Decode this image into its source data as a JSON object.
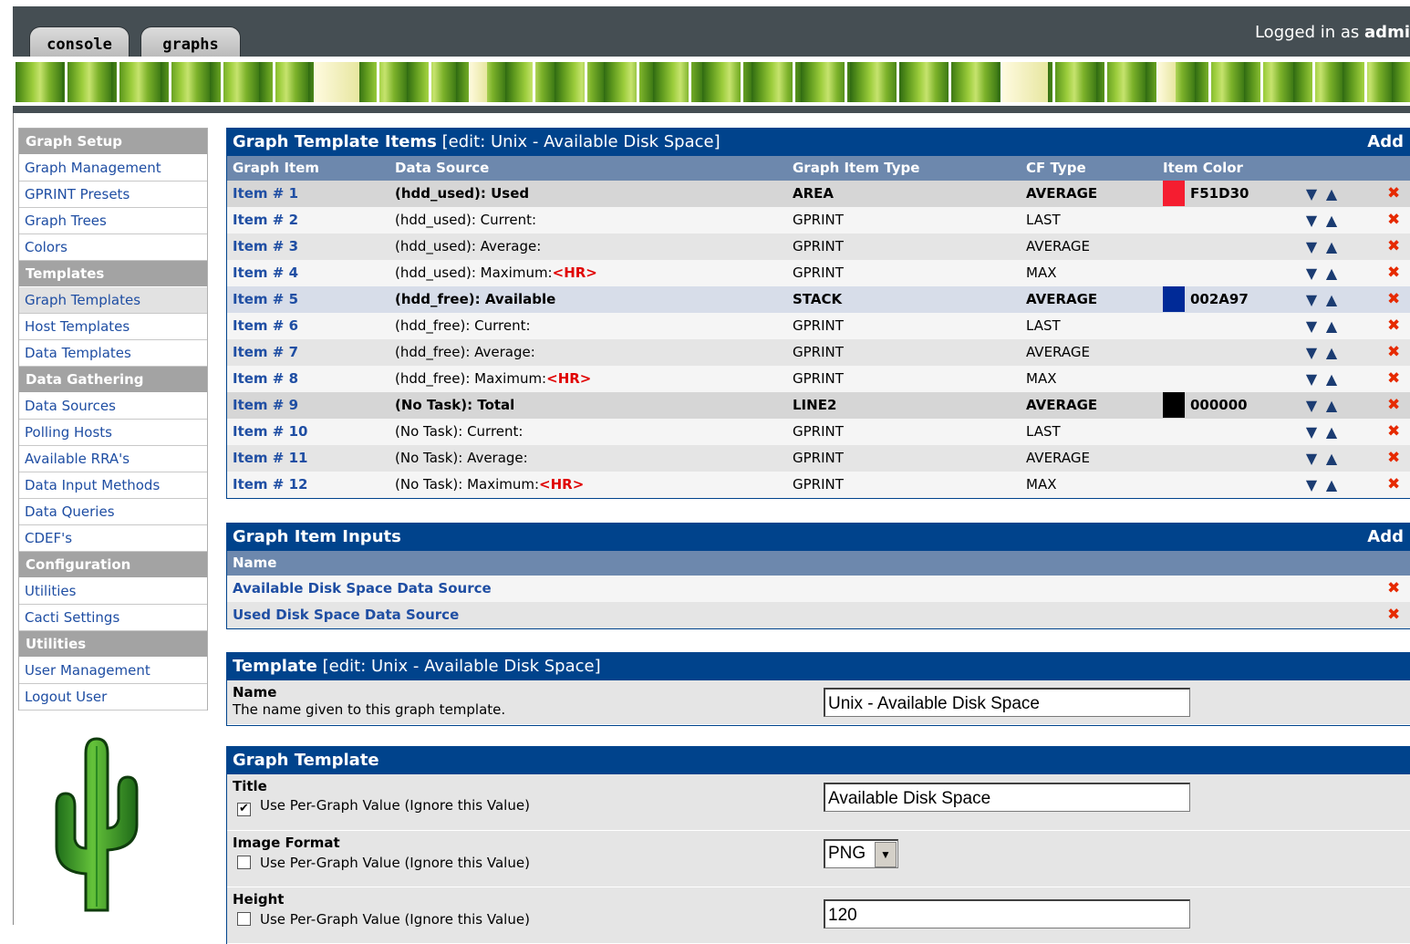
{
  "header": {
    "tabs": [
      "console",
      "graphs"
    ],
    "login_prefix": "Logged in as ",
    "login_user": "admi"
  },
  "sidebar": [
    {
      "type": "header",
      "label": "Graph Setup"
    },
    {
      "type": "item",
      "label": "Graph Management"
    },
    {
      "type": "item",
      "label": "GPRINT Presets"
    },
    {
      "type": "item",
      "label": "Graph Trees"
    },
    {
      "type": "item",
      "label": "Colors"
    },
    {
      "type": "header",
      "label": "Templates"
    },
    {
      "type": "item",
      "label": "Graph Templates",
      "active": true
    },
    {
      "type": "item",
      "label": "Host Templates"
    },
    {
      "type": "item",
      "label": "Data Templates"
    },
    {
      "type": "header",
      "label": "Data Gathering"
    },
    {
      "type": "item",
      "label": "Data Sources"
    },
    {
      "type": "item",
      "label": "Polling Hosts"
    },
    {
      "type": "item",
      "label": "Available RRA's"
    },
    {
      "type": "item",
      "label": "Data Input Methods"
    },
    {
      "type": "item",
      "label": "Data Queries"
    },
    {
      "type": "item",
      "label": "CDEF's"
    },
    {
      "type": "header",
      "label": "Configuration"
    },
    {
      "type": "item",
      "label": "Utilities"
    },
    {
      "type": "item",
      "label": "Cacti Settings"
    },
    {
      "type": "header",
      "label": "Utilities"
    },
    {
      "type": "item",
      "label": "User Management"
    },
    {
      "type": "item",
      "label": "Logout User"
    }
  ],
  "items_panel": {
    "title": "Graph Template Items",
    "subtitle": "[edit: Unix - Available Disk Space]",
    "add_label": "Add",
    "columns": [
      "Graph Item",
      "Data Source",
      "Graph Item Type",
      "CF Type",
      "Item Color"
    ],
    "rows": [
      {
        "item": "Item # 1",
        "source": "(hdd_used): Used",
        "hr": "",
        "type": "AREA",
        "cf": "AVERAGE",
        "color": "F51D30",
        "swatch": "#f51d30",
        "emph": true,
        "style": "hl1"
      },
      {
        "item": "Item # 2",
        "source": "(hdd_used): Current:",
        "hr": "",
        "type": "GPRINT",
        "cf": "LAST",
        "color": "",
        "swatch": "",
        "emph": false,
        "style": "odd"
      },
      {
        "item": "Item # 3",
        "source": "(hdd_used): Average:",
        "hr": "",
        "type": "GPRINT",
        "cf": "AVERAGE",
        "color": "",
        "swatch": "",
        "emph": false,
        "style": "even"
      },
      {
        "item": "Item # 4",
        "source": "(hdd_used): Maximum:",
        "hr": "<HR>",
        "type": "GPRINT",
        "cf": "MAX",
        "color": "",
        "swatch": "",
        "emph": false,
        "style": "odd"
      },
      {
        "item": "Item # 5",
        "source": "(hdd_free): Available",
        "hr": "",
        "type": "STACK",
        "cf": "AVERAGE",
        "color": "002A97",
        "swatch": "#002a97",
        "emph": true,
        "style": "hl2"
      },
      {
        "item": "Item # 6",
        "source": "(hdd_free): Current:",
        "hr": "",
        "type": "GPRINT",
        "cf": "LAST",
        "color": "",
        "swatch": "",
        "emph": false,
        "style": "odd"
      },
      {
        "item": "Item # 7",
        "source": "(hdd_free): Average:",
        "hr": "",
        "type": "GPRINT",
        "cf": "AVERAGE",
        "color": "",
        "swatch": "",
        "emph": false,
        "style": "even"
      },
      {
        "item": "Item # 8",
        "source": "(hdd_free): Maximum:",
        "hr": "<HR>",
        "type": "GPRINT",
        "cf": "MAX",
        "color": "",
        "swatch": "",
        "emph": false,
        "style": "odd"
      },
      {
        "item": "Item # 9",
        "source": "(No Task): Total",
        "hr": "",
        "type": "LINE2",
        "cf": "AVERAGE",
        "color": "000000",
        "swatch": "#000000",
        "emph": true,
        "style": "hl1"
      },
      {
        "item": "Item # 10",
        "source": "(No Task): Current:",
        "hr": "",
        "type": "GPRINT",
        "cf": "LAST",
        "color": "",
        "swatch": "",
        "emph": false,
        "style": "odd"
      },
      {
        "item": "Item # 11",
        "source": "(No Task): Average:",
        "hr": "",
        "type": "GPRINT",
        "cf": "AVERAGE",
        "color": "",
        "swatch": "",
        "emph": false,
        "style": "even"
      },
      {
        "item": "Item # 12",
        "source": "(No Task): Maximum:",
        "hr": "<HR>",
        "type": "GPRINT",
        "cf": "MAX",
        "color": "",
        "swatch": "",
        "emph": false,
        "style": "odd"
      }
    ]
  },
  "inputs_panel": {
    "title": "Graph Item Inputs",
    "add_label": "Add",
    "column": "Name",
    "rows": [
      "Available Disk Space Data Source",
      "Used Disk Space Data Source"
    ]
  },
  "template_panel": {
    "title": "Template",
    "subtitle": "[edit: Unix - Available Disk Space]",
    "name_label": "Name",
    "name_desc": "The name given to this graph template.",
    "name_value": "Unix - Available Disk Space"
  },
  "graph_template_panel": {
    "title": "Graph Template",
    "fields": [
      {
        "label": "Title",
        "checkbox_label": "Use Per-Graph Value (Ignore this Value)",
        "checked": true,
        "kind": "text",
        "value": "Available Disk Space"
      },
      {
        "label": "Image Format",
        "checkbox_label": "Use Per-Graph Value (Ignore this Value)",
        "checked": false,
        "kind": "select",
        "value": "PNG"
      },
      {
        "label": "Height",
        "checkbox_label": "Use Per-Graph Value (Ignore this Value)",
        "checked": false,
        "kind": "text",
        "value": "120"
      }
    ]
  },
  "icons": {
    "down": "arrow-down-icon",
    "up": "arrow-up-icon",
    "delete": "delete-x-icon",
    "logo": "cactus-logo"
  }
}
